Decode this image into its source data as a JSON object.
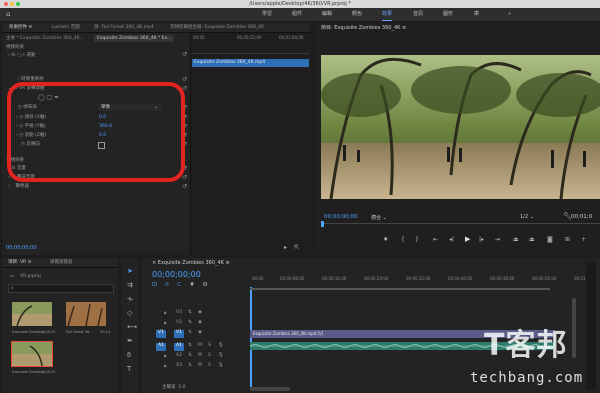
{
  "window": {
    "title": "/Users/apple/Desktop/4K/360/VR.prproj *"
  },
  "workspaces": [
    "學習",
    "組件",
    "編輯",
    "顏色",
    "效果",
    "音訊",
    "圖形",
    "庫",
    "»"
  ],
  "effects_panel": {
    "tabs": [
      "效果控件 ≡",
      "Lumetri 范圍",
      "源: Fall Forest 360_4K.mp4",
      "音頻剪輯混合器: Exquisite Zombies 360_4K"
    ],
    "clip_master": "主要 * Exquisite Zombies 360_4K...",
    "clip_sequence": "Exquisite Zombies 360_4K * Ex...",
    "section_video": "視頻效果",
    "motion": "運動",
    "time_remap": "時間重映射",
    "vr_effect": "VR 旋轉球體",
    "params": [
      {
        "label": "幀布局",
        "value": "單像"
      },
      {
        "label": "傾斜 (X軸)",
        "value": "0.0"
      },
      {
        "label": "平視 (Y軸)",
        "value": "360.0"
      },
      {
        "label": "滾動 (Z軸)",
        "value": "0.0"
      },
      {
        "label": "反轉向",
        "value": ""
      }
    ],
    "section_audio": "音頻效果",
    "audio_items": [
      "音量",
      "聲道音量",
      "聲像器"
    ],
    "timecode": "00;00;00;00",
    "mini_ruler": [
      "00;00",
      "00;00;32;00",
      "00;01;04;00"
    ],
    "mini_clip": "Exquisite Zombies 360_4K.mp4"
  },
  "program": {
    "title": "節目: Exquisite Zombies 360_4K ≡",
    "timecode": "00;00;00;00",
    "fit": "適合",
    "fraction": "1/2",
    "duration": "00;01;0"
  },
  "project": {
    "tabs": [
      "項目: VR ≡",
      "媒體瀏覽器"
    ],
    "file": "VR.prproj",
    "thumbs": [
      {
        "name": "Exquisite Zombies...",
        "dur": "1;05;25"
      },
      {
        "name": "Fall Forest 36...",
        "dur": "20;14"
      },
      {
        "name": "Exquisite Zombies...",
        "dur": "1;05;25"
      }
    ]
  },
  "timeline": {
    "title": "Exquisite Zombies 360_4K ≡",
    "timecode": "00;00;00;00",
    "ruler": [
      "00;00",
      "00;00;08;00",
      "00;00;16;00",
      "00;00;24;00",
      "00;00;32;00",
      "00;00;40;00",
      "00;00;48;00",
      "00;00;56;00",
      "00;01"
    ],
    "track_labels": [
      "V3",
      "V2",
      "V1",
      "A1",
      "A2",
      "A3"
    ],
    "clip_v": "Exquisite Zombies 360_4K.mp4 [V]",
    "master": "主聲道",
    "master_val": "0.0"
  },
  "watermark": {
    "brand": "T客邦",
    "domain": "techbang.com"
  },
  "colors": {
    "accent": "#4fa2ff",
    "annotation": "#e0241e"
  }
}
